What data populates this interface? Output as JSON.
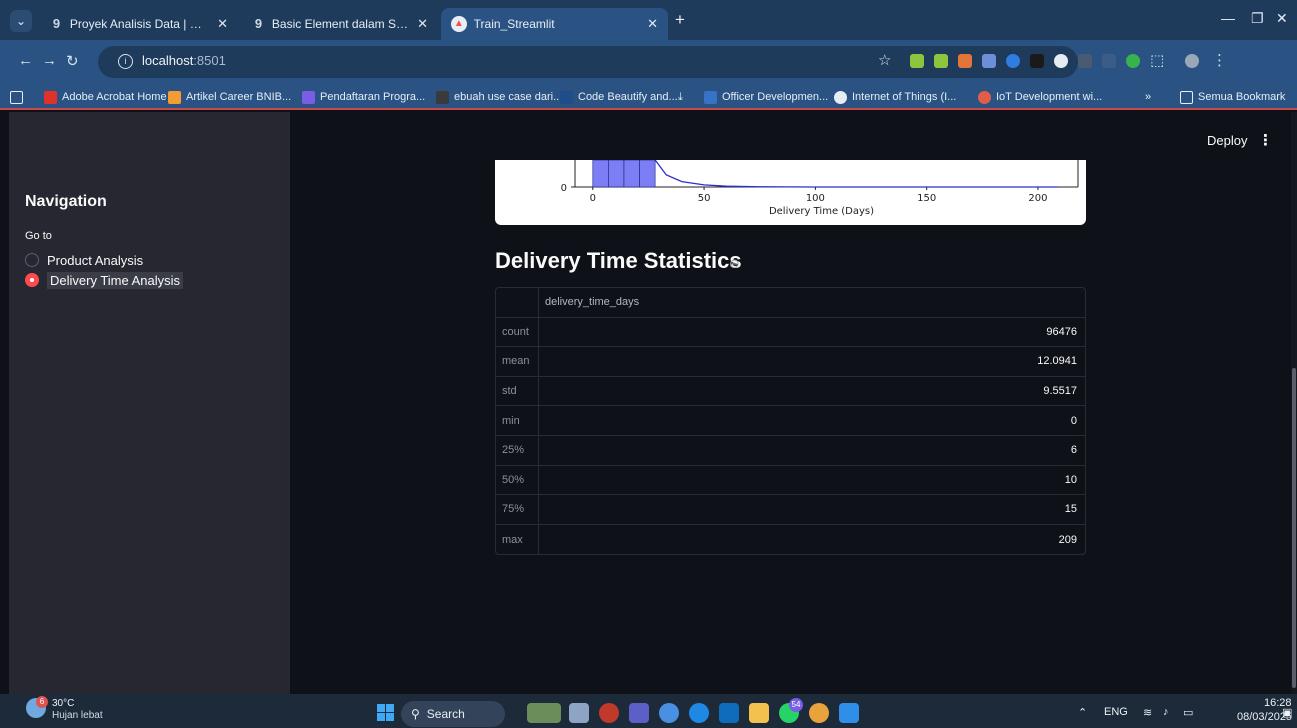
{
  "browser": {
    "tabs": [
      {
        "title": "Proyek Analisis Data | Dicoding",
        "icon": "dicoding-icon"
      },
      {
        "title": "Basic Element dalam Streamlit |",
        "icon": "dicoding-icon"
      },
      {
        "title": "Train_Streamlit",
        "icon": "streamlit-icon",
        "active": true
      }
    ],
    "url_host": "localhost",
    "url_port": ":8501",
    "bookmarks": [
      "Adobe Acrobat Home",
      "Artikel Career BNIB...",
      "Pendaftaran Progra...",
      "ebuah use case dari...",
      "Code Beautify and...",
      "Officer Developmen...",
      "Internet of Things (I...",
      "IoT Development wi..."
    ],
    "bookmarks_folder": "Semua Bookmark",
    "bookmarks_more": "»"
  },
  "sidebar": {
    "title": "Navigation",
    "radio_label": "Go to",
    "options": [
      "Product Analysis",
      "Delivery Time Analysis"
    ],
    "selected": "Delivery Time Analysis"
  },
  "header": {
    "deploy_label": "Deploy",
    "menu_glyph": "⋮"
  },
  "chart_data": {
    "type": "bar",
    "xlabel": "Delivery Time (Days)",
    "xticks": [
      "0",
      "50",
      "100",
      "150",
      "200"
    ],
    "xlim": [
      -8,
      218
    ],
    "yticks": [
      "0"
    ],
    "bar_color": "#7b7ef5",
    "bar_edges": [
      0,
      7,
      14,
      21,
      28
    ],
    "bars_visible_note": "",
    "kde_x": [
      28,
      33,
      40,
      50,
      60,
      75,
      100,
      150,
      209
    ],
    "kde_y": [
      1.0,
      0.45,
      0.2,
      0.08,
      0.03,
      0.01,
      0.0,
      0.0,
      0.0
    ]
  },
  "statistics": {
    "heading": "Delivery Time Statistics",
    "column": "delivery_time_days",
    "rows": [
      {
        "label": "count",
        "value": "96476"
      },
      {
        "label": "mean",
        "value": "12.0941"
      },
      {
        "label": "std",
        "value": "9.5517"
      },
      {
        "label": "min",
        "value": "0"
      },
      {
        "label": "25%",
        "value": "6"
      },
      {
        "label": "50%",
        "value": "10"
      },
      {
        "label": "75%",
        "value": "15"
      },
      {
        "label": "max",
        "value": "209"
      }
    ]
  },
  "taskbar": {
    "weather_temp": "30°C",
    "weather_desc": "Hujan lebat",
    "weather_badge": "6",
    "search_label": "Search",
    "whatsapp_badge": "54",
    "language": "ENG",
    "time": "16:28",
    "date": "08/03/2025"
  }
}
